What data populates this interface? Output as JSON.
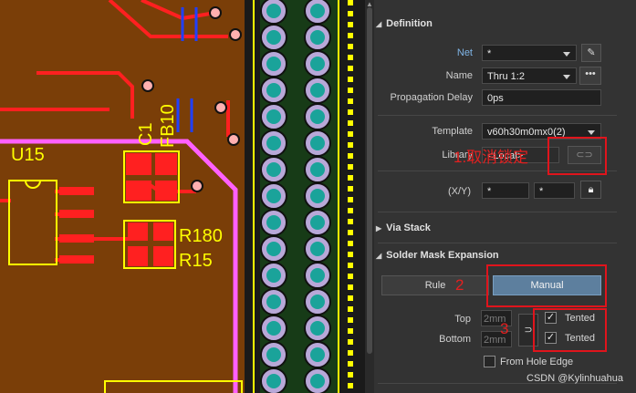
{
  "pcb": {
    "designators": {
      "u15": "U15",
      "c1": "C1",
      "fb10": "FB10",
      "r180": "R180",
      "r15": "R15"
    },
    "colors": {
      "board": "#7a3e08",
      "trace": "#ff2020",
      "outline": "#ffff00",
      "pad": "#1aa39a",
      "keepout": "#ff60ff"
    }
  },
  "panel": {
    "definition": {
      "header": "Definition",
      "net_label": "Net",
      "net_value": "*",
      "name_label": "Name",
      "name_value": "Thru 1:2",
      "prop_delay_label": "Propagation Delay",
      "prop_delay_value": "0ps",
      "template_label": "Template",
      "template_value": "v60h30m0mx0(2)",
      "library_label": "Library",
      "library_value": "<Local>",
      "xy_label": "(X/Y)",
      "x_value": "*",
      "y_value": "*"
    },
    "via_stack": {
      "header": "Via Stack"
    },
    "solder_mask": {
      "header": "Solder Mask Expansion",
      "rule_label": "Rule",
      "manual_label": "Manual",
      "top_label": "Top",
      "top_value": "2mm",
      "bottom_label": "Bottom",
      "bottom_value": "2mm",
      "tented_top_label": "Tented",
      "tented_bottom_label": "Tented",
      "from_hole_edge_label": "From Hole Edge"
    }
  },
  "annotations": {
    "note1": "1.取消锁定",
    "note2": "2",
    "note3": "3"
  },
  "watermark": "CSDN @Kylinhuahua"
}
